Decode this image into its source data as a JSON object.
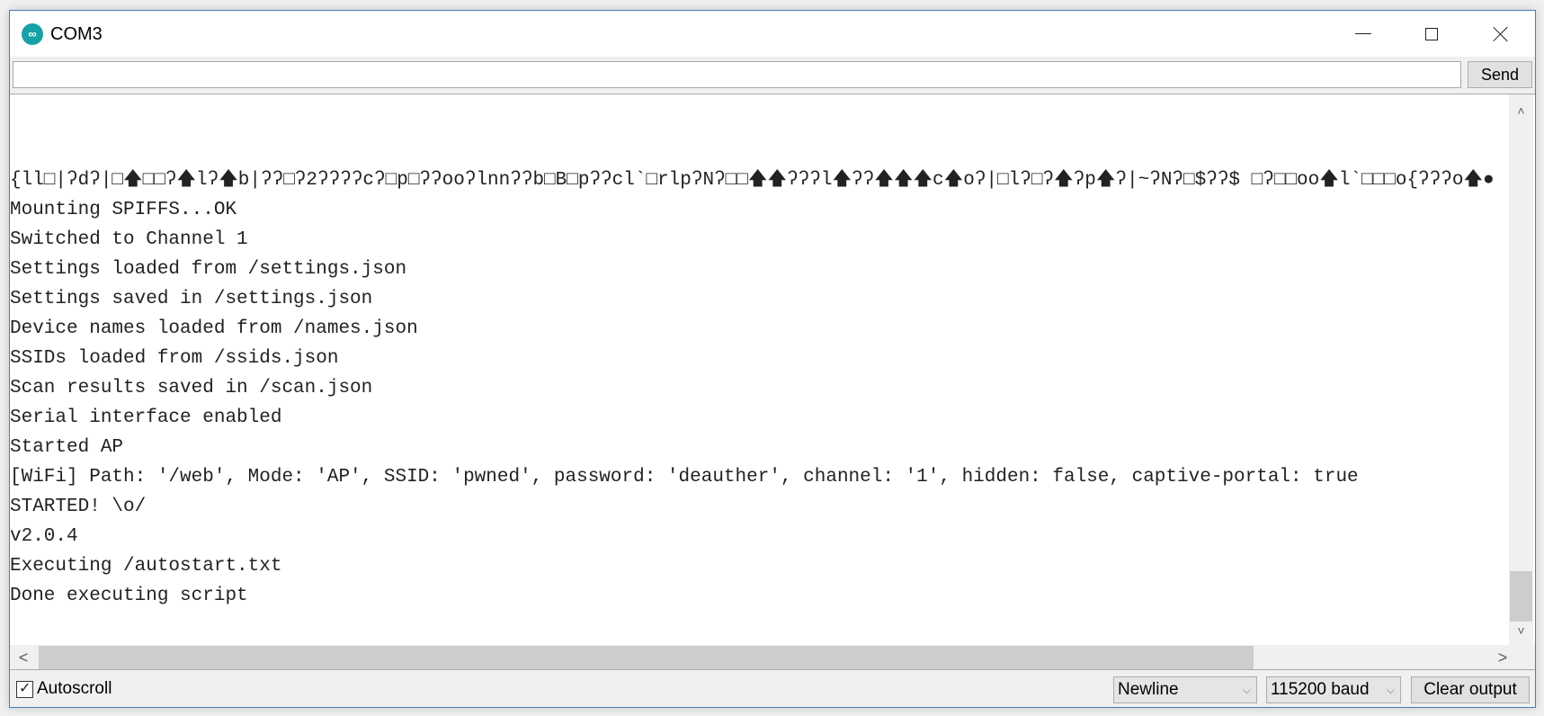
{
  "window": {
    "title": "COM3",
    "app_icon": "arduino-infinity-icon",
    "controls": {
      "minimize": "minimize-icon",
      "maximize": "maximize-icon",
      "close": "close-icon"
    }
  },
  "send_bar": {
    "input_value": "",
    "send_label": "Send"
  },
  "output": {
    "lines": [
      "{ll□|ʔdʔ|□🡅□□ʔ🡅lʔ🡅b|ʔʔ□ʔ2ʔʔʔʔcʔ□p□ʔʔooʔlnnʔʔb□B□pʔʔcl`□rlpʔNʔ□□🡅🡅ʔʔʔl🡅ʔʔ🡅🡅🡅c🡅oʔ|□lʔ□ʔ🡅ʔp🡅ʔ|~ʔNʔ□$ʔʔ$ □ʔ□□oo🡅l`□□□o{ʔʔʔo🡅●",
      "Mounting SPIFFS...OK",
      "Switched to Channel 1",
      "Settings loaded from /settings.json",
      "Settings saved in /settings.json",
      "Device names loaded from /names.json",
      "SSIDs loaded from /ssids.json",
      "Scan results saved in /scan.json",
      "Serial interface enabled",
      "Started AP",
      "[WiFi] Path: '/web', Mode: 'AP', SSID: 'pwned', password: 'deauther', channel: '1', hidden: false, captive-portal: true",
      "STARTED! \\o/",
      "v2.0.4",
      "Executing /autostart.txt",
      "Done executing script"
    ]
  },
  "scrollbars": {
    "vertical": {
      "up": "˄",
      "down": "˅",
      "position": 0.93
    },
    "horizontal": {
      "left": "<",
      "right": ">",
      "position": 0.0
    }
  },
  "bottom_bar": {
    "autoscroll_label": "Autoscroll",
    "autoscroll_checked": true,
    "line_ending": "Newline",
    "baud_rate": "115200 baud",
    "clear_label": "Clear output"
  }
}
